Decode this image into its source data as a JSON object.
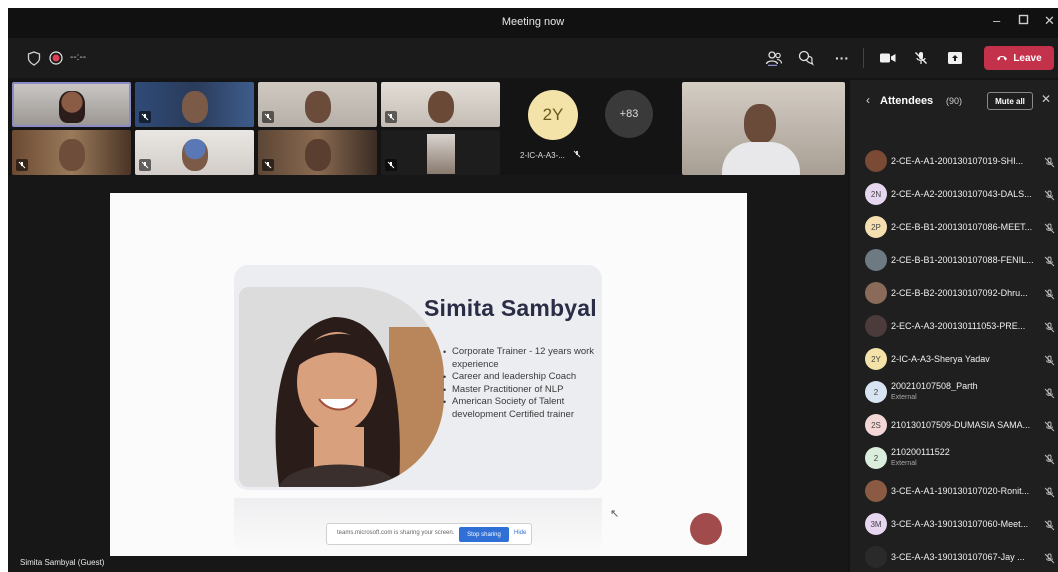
{
  "window": {
    "title": "Meeting now"
  },
  "toolbar": {
    "timer": "--:--",
    "leave_label": "Leave"
  },
  "video_strip": {
    "avatar_initials": "2Y",
    "avatar_label": "2-IC-A-A3-...",
    "overflow_count": "+83"
  },
  "slide": {
    "name": "Simita Sambyal",
    "bullets": [
      "Corporate Trainer - 12 years work experience",
      "Career and leadership Coach",
      "Master Practitioner of NLP",
      "American Society of Talent development Certified trainer"
    ],
    "share_bar": {
      "text": "teams.microsoft.com is sharing your screen.",
      "stop_label": "Stop sharing",
      "hide_label": "Hide"
    }
  },
  "presenter_label": "Simita Sambyal (Guest)",
  "panel": {
    "title": "Attendees",
    "count": "(90)",
    "mute_all": "Mute all",
    "attendees": [
      {
        "name": "2-CE-A-A1-200130107019-SHI...",
        "initials": "",
        "color": "#7a4a35",
        "sub": ""
      },
      {
        "name": "2-CE-A-A2-200130107043-DALS...",
        "initials": "2N",
        "color": "#e6d6f0",
        "sub": ""
      },
      {
        "name": "2-CE-B-B1-200130107086-MEET...",
        "initials": "2P",
        "color": "#f5dfb0",
        "sub": ""
      },
      {
        "name": "2-CE-B-B1-200130107088-FENIL...",
        "initials": "",
        "color": "#6d7a82",
        "sub": ""
      },
      {
        "name": "2-CE-B-B2-200130107092-Dhru...",
        "initials": "",
        "color": "#8a6b5a",
        "sub": ""
      },
      {
        "name": "2-EC-A-A3-200130111053-PRE...",
        "initials": "",
        "color": "#4b3b3b",
        "sub": ""
      },
      {
        "name": "2-IC-A-A3-Sherya Yadav",
        "initials": "2Y",
        "color": "#f3e3a8",
        "sub": ""
      },
      {
        "name": "200210107508_Parth",
        "initials": "2",
        "color": "#d8e4f2",
        "sub": "External"
      },
      {
        "name": "210130107509-DUMASIA SAMA...",
        "initials": "2S",
        "color": "#f3d6d6",
        "sub": ""
      },
      {
        "name": "210200111522",
        "initials": "2",
        "color": "#dbeedd",
        "sub": "External"
      },
      {
        "name": "3-CE-A-A1-190130107020-Ronit...",
        "initials": "",
        "color": "#8a5a42",
        "sub": ""
      },
      {
        "name": "3-CE-A-A3-190130107060-Meet...",
        "initials": "3M",
        "color": "#e6d6f0",
        "sub": ""
      },
      {
        "name": "3-CE-A-A3-190130107067-Jay ...",
        "initials": "",
        "color": "#2a2a2a",
        "sub": ""
      }
    ]
  },
  "colors": {
    "leave": "#c4314b",
    "accent": "#6264a7",
    "stop_sharing": "#2f6fd6"
  }
}
